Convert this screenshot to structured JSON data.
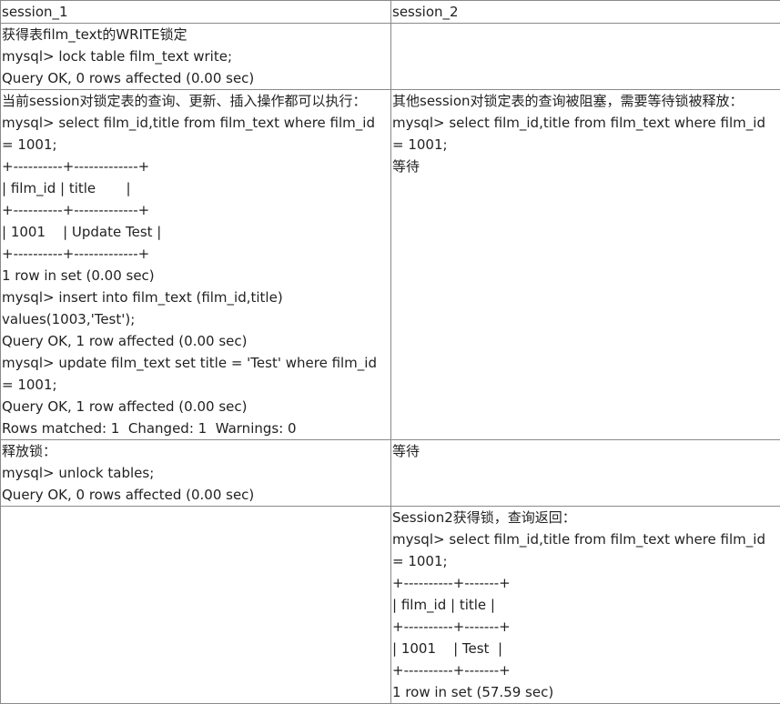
{
  "header": {
    "session1": "session_1",
    "session2": "session_2"
  },
  "rows": [
    {
      "session1": [
        "获得表film_text的WRITE锁定",
        "mysql> lock table film_text write;",
        "Query OK, 0 rows affected (0.00 sec)"
      ],
      "session2": []
    },
    {
      "session1": [
        "当前session对锁定表的查询、更新、插入操作都可以执行：",
        "mysql> select film_id,title from film_text where film_id = 1001;",
        "+----------+-------------+",
        "| film_id | title       |",
        "+----------+-------------+",
        "| 1001    | Update Test |",
        "+----------+-------------+",
        "1 row in set (0.00 sec)",
        "mysql> insert into film_text (film_id,title) values(1003,'Test');",
        "Query OK, 1 row affected (0.00 sec)",
        "mysql> update film_text set title = 'Test' where film_id = 1001;",
        "Query OK, 1 row affected (0.00 sec)",
        "Rows matched: 1  Changed: 1  Warnings: 0"
      ],
      "session2": [
        "其他session对锁定表的查询被阻塞，需要等待锁被释放：",
        "mysql> select film_id,title from film_text where film_id = 1001;",
        "等待"
      ]
    },
    {
      "session1": [
        "释放锁：",
        "mysql> unlock tables;",
        "Query OK, 0 rows affected (0.00 sec)"
      ],
      "session2": [
        "等待"
      ]
    },
    {
      "session1": [],
      "session2": [
        "Session2获得锁，查询返回：",
        "mysql> select film_id,title from film_text where film_id = 1001;",
        "+----------+-------+",
        "| film_id | title |",
        "+----------+-------+",
        "| 1001    | Test  |",
        "+----------+-------+",
        "1 row in set (57.59 sec)"
      ]
    }
  ]
}
